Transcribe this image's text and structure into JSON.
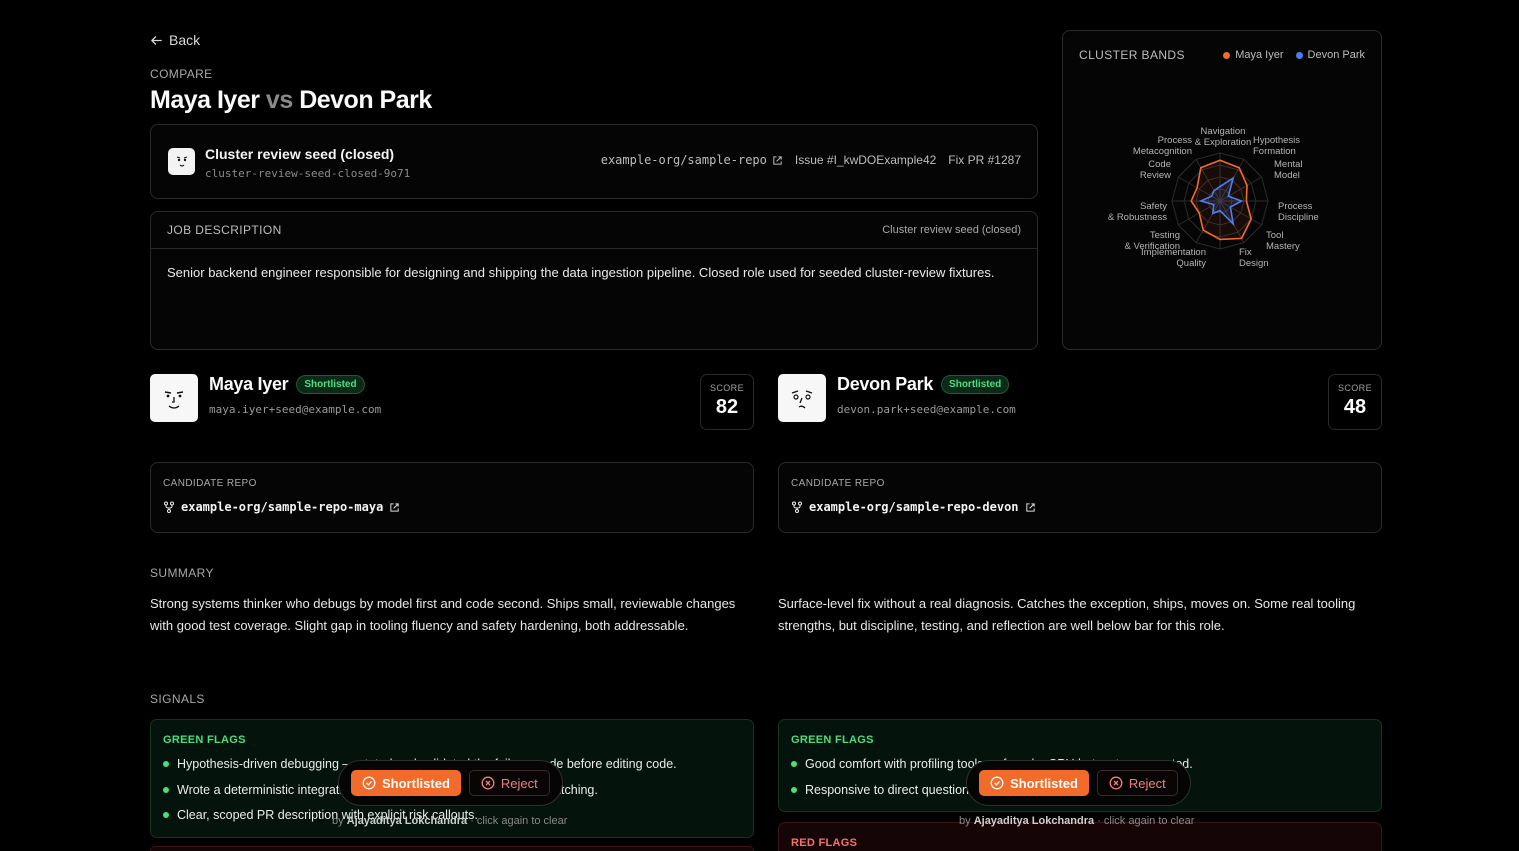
{
  "nav": {
    "back_label": "Back"
  },
  "header": {
    "eyebrow": "COMPARE",
    "candidate_a": "Maya Iyer",
    "vs": "vs",
    "candidate_b": "Devon Park"
  },
  "seed": {
    "title": "Cluster review seed (closed)",
    "slug": "cluster-review-seed-closed-9o71",
    "repo": "example-org/sample-repo",
    "issue": "Issue #I_kwDOExample42",
    "fix_pr": "Fix PR #1287"
  },
  "job": {
    "label": "JOB DESCRIPTION",
    "context": "Cluster review seed (closed)",
    "text": "Senior backend engineer responsible for designing and shipping the data ingestion pipeline. Closed role used for seeded cluster-review fixtures."
  },
  "radar": {
    "title": "CLUSTER BANDS",
    "legend": [
      {
        "name": "Maya Iyer",
        "color": "#f26b2a"
      },
      {
        "name": "Devon Park",
        "color": "#4f7cf0"
      }
    ],
    "axes": [
      "Navigation & Exploration",
      "Hypothesis Formation",
      "Mental Model",
      "Process Discipline",
      "Tool Mastery",
      "Fix Design",
      "Implementation Quality",
      "Testing & Verification",
      "Safety & Robustness",
      "Code Review",
      "Metacognition",
      "Process"
    ],
    "axis_labels": {
      "navigation": "Navigation",
      "exploration": "& Exploration",
      "hypothesis": "Hypothesis",
      "formation": "Formation",
      "mental": "Mental",
      "model": "Model",
      "process_d": "Process",
      "discipline": "Discipline",
      "tool": "Tool",
      "mastery": "Mastery",
      "fix": "Fix",
      "design": "Design",
      "implementation": "Implementation",
      "quality": "Quality",
      "testing": "Testing",
      "verification": "& Verification",
      "safety": "Safety",
      "robustness": "& Robustness",
      "code": "Code",
      "review": "Review",
      "metacognition": "Metacognition",
      "process": "Process"
    },
    "series": [
      {
        "name": "Maya Iyer",
        "values": [
          0.85,
          0.8,
          0.65,
          0.55,
          0.75,
          0.9,
          0.8,
          0.7,
          0.5,
          0.6,
          0.55,
          0.8
        ]
      },
      {
        "name": "Devon Park",
        "values": [
          0.3,
          0.55,
          0.2,
          0.45,
          0.25,
          0.55,
          0.2,
          0.3,
          0.15,
          0.4,
          0.2,
          0.25
        ]
      }
    ]
  },
  "candidates": [
    {
      "name": "Maya Iyer",
      "status": "Shortlisted",
      "email": "maya.iyer+seed@example.com",
      "score_label": "SCORE",
      "score": "82",
      "repo_label": "CANDIDATE REPO",
      "repo": "example-org/sample-repo-maya",
      "summary": "Strong systems thinker who debugs by model first and code second. Ships small, reviewable changes with good test coverage. Slight gap in tooling fluency and safety hardening, both addressable.",
      "green_flags_label": "GREEN FLAGS",
      "green_flags": [
        "Hypothesis-driven debugging — stated and validated the failure mode before editing code.",
        "Wrote a deterministic integration test before touching the ingestion batching.",
        "Clear, scoped PR description with explicit risk callouts."
      ],
      "actions": {
        "shortlist": "Shortlisted",
        "reject": "Reject",
        "by": "by",
        "reviewer": "Ajayaditya Lokchandra",
        "hint": "· click again to clear"
      }
    },
    {
      "name": "Devon Park",
      "status": "Shortlisted",
      "email": "devon.park+seed@example.com",
      "score_label": "SCORE",
      "score": "48",
      "repo_label": "CANDIDATE REPO",
      "repo": "example-org/sample-repo-devon",
      "summary": "Surface-level fix without a real diagnosis. Catches the exception, ships, moves on. Some real tooling strengths, but discipline, testing, and reflection are well below bar for this role.",
      "green_flags_label": "GREEN FLAGS",
      "green_flags": [
        "Good comfort with profiling tools — found a CPU hotspot unprompted.",
        "Responsive to direct questions when nudged."
      ],
      "red_flags_label": "RED FLAGS",
      "actions": {
        "shortlist": "Shortlisted",
        "reject": "Reject",
        "by": "by",
        "reviewer": "Ajayaditya Lokchandra",
        "hint": "· click again to clear"
      }
    }
  ],
  "sections": {
    "summary": "SUMMARY",
    "signals": "SIGNALS"
  },
  "colors": {
    "accent": "#f26b2a",
    "series_b": "#4f7cf0",
    "success": "#4ade80",
    "danger": "#f87171"
  }
}
